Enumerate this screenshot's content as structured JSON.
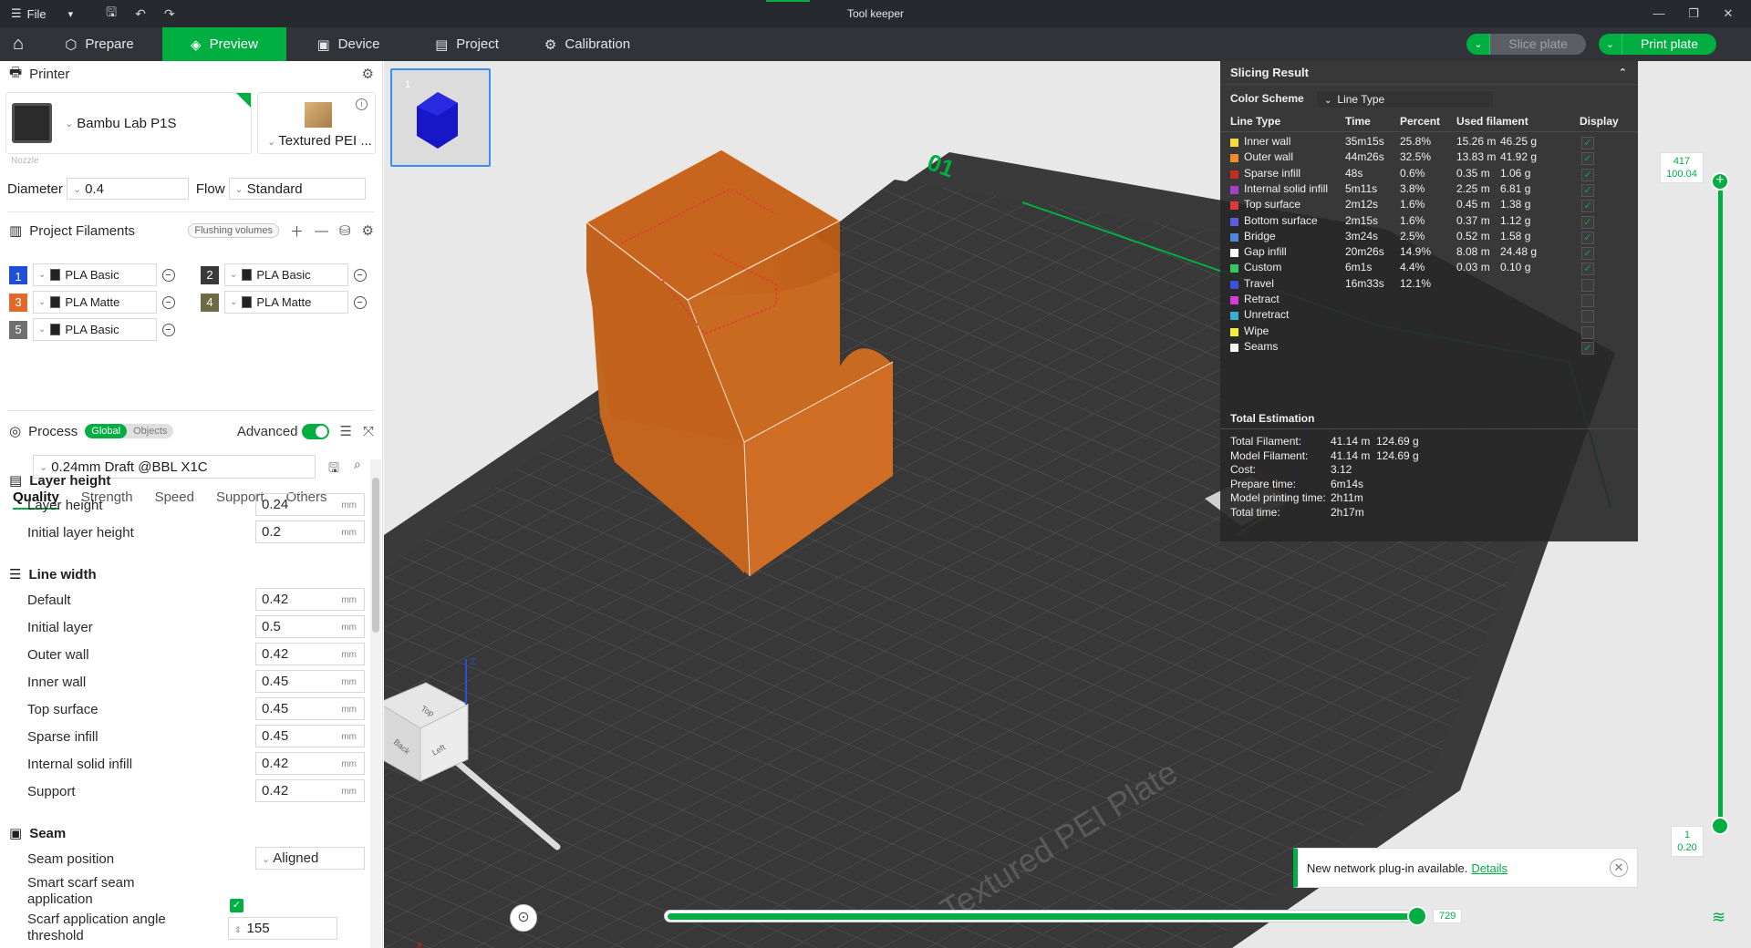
{
  "titlebar": {
    "file_label": "File",
    "title": "Tool keeper"
  },
  "toolbar": {
    "tabs": [
      {
        "label": "Prepare",
        "icon": "cube-icon"
      },
      {
        "label": "Preview",
        "icon": "layers-icon"
      },
      {
        "label": "Device",
        "icon": "device-icon"
      },
      {
        "label": "Project",
        "icon": "project-icon"
      },
      {
        "label": "Calibration",
        "icon": "calibration-icon"
      }
    ],
    "active_tab": "Preview",
    "slice_label": "Slice plate",
    "print_label": "Print plate"
  },
  "printer": {
    "section_label": "Printer",
    "name": "Bambu Lab P1S",
    "plate": "Textured PEI ...",
    "nozzle_label": "Nozzle",
    "diameter_label": "Diameter",
    "diameter": "0.4",
    "flow_label": "Flow",
    "flow": "Standard"
  },
  "filaments": {
    "section_label": "Project Filaments",
    "flush_label": "Flushing volumes",
    "items": [
      {
        "num": "1",
        "name": "PLA Basic",
        "color": "#1f4fd6"
      },
      {
        "num": "2",
        "name": "PLA Basic",
        "color": "#3a3a3a"
      },
      {
        "num": "3",
        "name": "PLA Matte",
        "color": "#e06a2a"
      },
      {
        "num": "4",
        "name": "PLA Matte",
        "color": "#6b6b45"
      },
      {
        "num": "5",
        "name": "PLA Basic",
        "color": "#6f6f6f"
      }
    ]
  },
  "process": {
    "section_label": "Process",
    "global_label": "Global",
    "objects_label": "Objects",
    "advanced_label": "Advanced",
    "preset": "0.24mm Draft @BBL X1C",
    "tabs": [
      "Quality",
      "Strength",
      "Speed",
      "Support",
      "Others"
    ],
    "active_tab": "Quality",
    "unit": "mm",
    "layer_height_group": "Layer height",
    "layer_height_label": "Layer height",
    "layer_height": "0.24",
    "initial_layer_height_label": "Initial layer height",
    "initial_layer_height": "0.2",
    "line_width_group": "Line width",
    "line_widths": [
      {
        "label": "Default",
        "value": "0.42"
      },
      {
        "label": "Initial layer",
        "value": "0.5"
      },
      {
        "label": "Outer wall",
        "value": "0.42"
      },
      {
        "label": "Inner wall",
        "value": "0.45"
      },
      {
        "label": "Top surface",
        "value": "0.45"
      },
      {
        "label": "Sparse infill",
        "value": "0.45"
      },
      {
        "label": "Internal solid infill",
        "value": "0.42"
      },
      {
        "label": "Support",
        "value": "0.42"
      }
    ],
    "seam_group": "Seam",
    "seam_position_label": "Seam position",
    "seam_position": "Aligned",
    "smart_scarf_label": "Smart scarf seam application",
    "scarf_angle_label": "Scarf application angle threshold",
    "scarf_angle": "155"
  },
  "slicing_result": {
    "title": "Slicing Result",
    "color_scheme_label": "Color Scheme",
    "color_scheme": "Line Type",
    "headers": [
      "Line Type",
      "Time",
      "Percent",
      "Used filament",
      "Display"
    ],
    "rows": [
      {
        "name": "Inner wall",
        "color": "#f5dc3c",
        "time": "35m15s",
        "percent": "25.8%",
        "len": "15.26 m",
        "weight": "46.25 g",
        "display": true
      },
      {
        "name": "Outer wall",
        "color": "#f08c2c",
        "time": "44m26s",
        "percent": "32.5%",
        "len": "13.83 m",
        "weight": "41.92 g",
        "display": true
      },
      {
        "name": "Sparse infill",
        "color": "#c42d20",
        "time": "48s",
        "percent": "0.6%",
        "len": "0.35 m",
        "weight": "1.06 g",
        "display": true
      },
      {
        "name": "Internal solid infill",
        "color": "#a43fc8",
        "time": "5m11s",
        "percent": "3.8%",
        "len": "2.25 m",
        "weight": "6.81 g",
        "display": true
      },
      {
        "name": "Top surface",
        "color": "#e0383c",
        "time": "2m12s",
        "percent": "1.6%",
        "len": "0.45 m",
        "weight": "1.38 g",
        "display": true
      },
      {
        "name": "Bottom surface",
        "color": "#5c5ce0",
        "time": "2m15s",
        "percent": "1.6%",
        "len": "0.37 m",
        "weight": "1.12 g",
        "display": true
      },
      {
        "name": "Bridge",
        "color": "#4f88d8",
        "time": "3m24s",
        "percent": "2.5%",
        "len": "0.52 m",
        "weight": "1.58 g",
        "display": true
      },
      {
        "name": "Gap infill",
        "color": "#ffffff",
        "time": "20m26s",
        "percent": "14.9%",
        "len": "8.08 m",
        "weight": "24.48 g",
        "display": true
      },
      {
        "name": "Custom",
        "color": "#32c864",
        "time": "6m1s",
        "percent": "4.4%",
        "len": "0.03 m",
        "weight": "0.10 g",
        "display": true
      },
      {
        "name": "Travel",
        "color": "#3c50dc",
        "time": "16m33s",
        "percent": "12.1%",
        "len": "",
        "weight": "",
        "display": false
      },
      {
        "name": "Retract",
        "color": "#d83cd8",
        "time": "",
        "percent": "",
        "len": "",
        "weight": "",
        "display": false
      },
      {
        "name": "Unretract",
        "color": "#38b0d0",
        "time": "",
        "percent": "",
        "len": "",
        "weight": "",
        "display": false
      },
      {
        "name": "Wipe",
        "color": "#f0f03c",
        "time": "",
        "percent": "",
        "len": "",
        "weight": "",
        "display": false
      },
      {
        "name": "Seams",
        "color": "#f4f4f4",
        "time": "",
        "percent": "",
        "len": "",
        "weight": "",
        "display": true
      }
    ],
    "total_title": "Total Estimation",
    "totals": [
      {
        "label": "Total Filament:",
        "v1": "41.14 m",
        "v2": "124.69 g"
      },
      {
        "label": "Model Filament:",
        "v1": "41.14 m",
        "v2": "124.69 g"
      },
      {
        "label": "Cost:",
        "v1": "3.12",
        "v2": ""
      },
      {
        "label": "Prepare time:",
        "v1": "6m14s",
        "v2": ""
      },
      {
        "label": "Model printing time:",
        "v1": "2h11m",
        "v2": ""
      },
      {
        "label": "Total time:",
        "v1": "2h17m",
        "v2": ""
      }
    ]
  },
  "viewport": {
    "plate_number": "1",
    "plate_id": "01",
    "plate_text": "Textured PEI Plate",
    "top_layer": "417",
    "top_height": "100.04",
    "bottom_layer": "1",
    "bottom_height": "0.20",
    "move_value": "729",
    "move_progress": 1.0,
    "cube_labels": {
      "top": "Top",
      "back": "Back",
      "left": "Left",
      "z": "Z",
      "x": "X"
    }
  },
  "notification": {
    "text": "New network plug-in available.",
    "link": "Details"
  }
}
